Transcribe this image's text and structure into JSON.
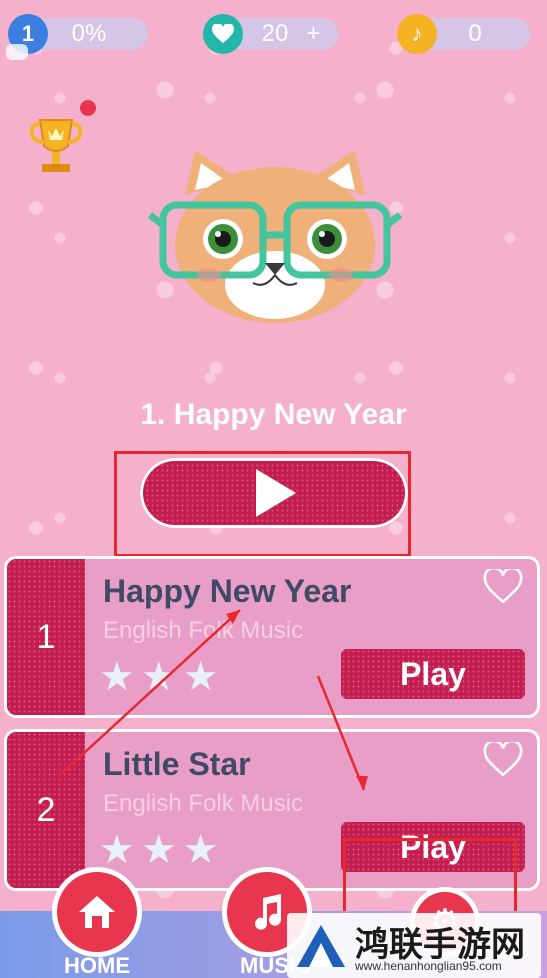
{
  "topbar": {
    "level": "1",
    "progress": "0%",
    "lives": "20",
    "lives_add": "+",
    "notes": "0"
  },
  "featured": {
    "title": "1. Happy New Year"
  },
  "songs": [
    {
      "number": "1",
      "title": "Happy New Year",
      "subtitle": "English Folk Music",
      "stars": "★★★",
      "play_label": "Play"
    },
    {
      "number": "2",
      "title": "Little Star",
      "subtitle": "English Folk Music",
      "stars": "★★★",
      "play_label": "Play"
    }
  ],
  "bottom_nav": {
    "home_label": "HOME",
    "music_label": "MUSIC"
  },
  "watermark": {
    "title": "鸿联手游网",
    "url": "www.henanhonglian95.com"
  },
  "colors": {
    "accent": "#c41d4f",
    "background": "#f5b0cc",
    "annotation": "#e8282f"
  }
}
